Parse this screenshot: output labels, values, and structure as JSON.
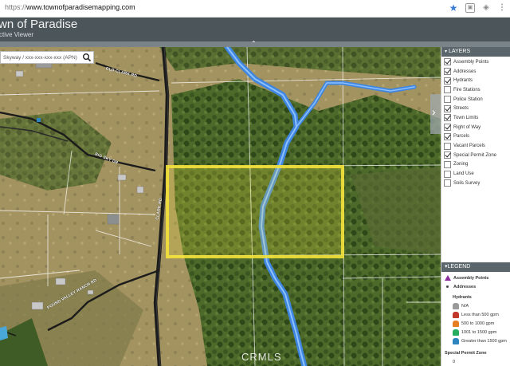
{
  "browser": {
    "url_protocol": "https://",
    "url_host": "www.townofparadisemapping.com",
    "icons": [
      "star-icon",
      "extension-icon",
      "extension-icon",
      "menu-icon"
    ]
  },
  "app": {
    "title": "wn of Paradise",
    "subtitle": "ctive Viewer"
  },
  "search": {
    "placeholder": "Skyway / xxx-xxx-xxx-xxx (APN)",
    "icon": "search-icon"
  },
  "map": {
    "road_labels": [
      "OLD CLARK RD",
      "BIG SKY DR",
      "CLARK RD",
      "POUND VALLEY RANCH RD"
    ],
    "watermark": "CRMLS",
    "colors": {
      "stream": "#4a90e8",
      "parcel_highlight": "#f3e23a",
      "road": "#1b1b1b",
      "parcel_line": "#ffffff"
    }
  },
  "layers": {
    "title": "LAYERS",
    "items": [
      {
        "label": "Assembly Points",
        "checked": true
      },
      {
        "label": "Addresses",
        "checked": true
      },
      {
        "label": "Hydrants",
        "checked": true
      },
      {
        "label": "Fire Stations",
        "checked": false
      },
      {
        "label": "Police Station",
        "checked": false
      },
      {
        "label": "Streets",
        "checked": true
      },
      {
        "label": "Town Limits",
        "checked": true
      },
      {
        "label": "Right of Way",
        "checked": true
      },
      {
        "label": "Parcels",
        "checked": true
      },
      {
        "label": "Vacant Parcels",
        "checked": false
      },
      {
        "label": "Special Permit Zone",
        "checked": true
      },
      {
        "label": "Zoning",
        "checked": false
      },
      {
        "label": "Land Use",
        "checked": false
      },
      {
        "label": "Soils Survey",
        "checked": false
      }
    ]
  },
  "legend": {
    "title": "LEGEND",
    "assembly_points": "Assembly Points",
    "addresses": "Addresses",
    "hydrants_heading": "Hydrants",
    "hydrant_classes": [
      {
        "label": "N/A",
        "color": "#9a9a9a"
      },
      {
        "label": "Less than 500 gpm",
        "color": "#c0392b"
      },
      {
        "label": "500 to 1000 gpm",
        "color": "#e67e22"
      },
      {
        "label": "1001 to 1500 gpm",
        "color": "#27ae60"
      },
      {
        "label": "Greater than 1500 gpm",
        "color": "#2e86c1"
      }
    ],
    "special_permit_heading": "Special Permit Zone",
    "special_permit_value": "0"
  }
}
